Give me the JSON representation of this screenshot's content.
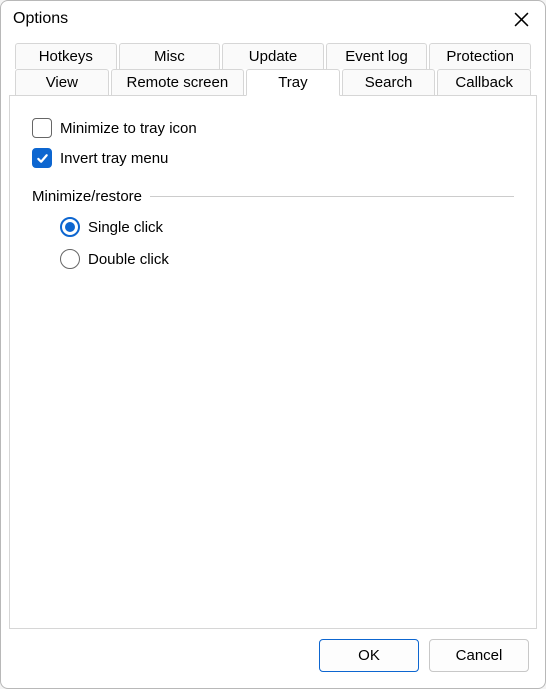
{
  "window": {
    "title": "Options"
  },
  "tabs": {
    "row1": [
      "Hotkeys",
      "Misc",
      "Update",
      "Event log",
      "Protection"
    ],
    "row2": [
      "View",
      "Remote screen",
      "Tray",
      "Search",
      "Callback"
    ],
    "active": "Tray"
  },
  "tray": {
    "minimize_to_tray": {
      "label": "Minimize to tray icon",
      "checked": false
    },
    "invert_tray_menu": {
      "label": "Invert tray menu",
      "checked": true
    },
    "group_label": "Minimize/restore",
    "click_mode": {
      "options": [
        {
          "label": "Single click",
          "selected": true
        },
        {
          "label": "Double click",
          "selected": false
        }
      ]
    }
  },
  "buttons": {
    "ok": "OK",
    "cancel": "Cancel"
  }
}
